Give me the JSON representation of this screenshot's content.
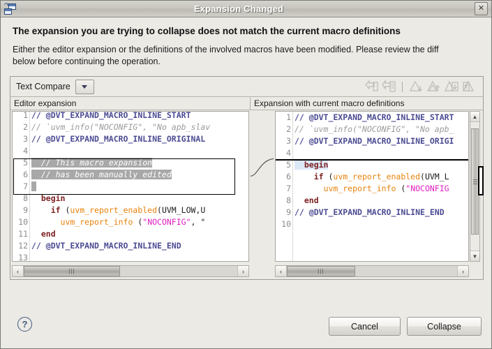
{
  "window": {
    "title": "Expansion Changed",
    "icon": "compare-windows-icon",
    "close_label": "✕"
  },
  "header": {
    "heading": "The expansion you are trying to collapse does not match the current macro definitions",
    "description": "Either the editor expansion or the definitions of the involved macros have been modified. Please review the diff below before continuing the operation."
  },
  "compare_viewer": {
    "mode_label": "Text Compare",
    "dropdown_icon": "chevron-down-icon",
    "toolbar_icons": [
      "copy-all-left-to-right-icon",
      "copy-current-change-icon",
      "next-difference-icon",
      "previous-difference-icon",
      "next-change-icon",
      "previous-change-icon"
    ],
    "left_pane": {
      "header": "Editor expansion",
      "lines": [
        {
          "num": "1",
          "tokens": [
            {
              "t": "// @DVT_EXPAND_MACRO_INLINE_START",
              "c": "c-cmt"
            }
          ]
        },
        {
          "num": "2",
          "tokens": [
            {
              "t": "// ",
              "c": "c-cmt-i"
            },
            {
              "t": "`uvm_info(\"NOCONFIG\", \"No apb_slav",
              "c": "c-cmt-i"
            }
          ]
        },
        {
          "num": "3",
          "tokens": [
            {
              "t": "// @DVT_EXPAND_MACRO_INLINE_ORIGINAL",
              "c": "c-cmt"
            }
          ]
        },
        {
          "num": "4",
          "tokens": []
        },
        {
          "num": "5",
          "tokens": [
            {
              "t": "  // This macro expansion",
              "c": "c-cmt-i hl-gray"
            }
          ]
        },
        {
          "num": "6",
          "tokens": [
            {
              "t": "  // has been manually edited",
              "c": "c-cmt-i hl-gray"
            }
          ]
        },
        {
          "num": "7",
          "tokens": [
            {
              "t": " ",
              "c": "hl-gray"
            }
          ]
        },
        {
          "num": "8",
          "tokens": [
            {
              "t": "  begin",
              "c": "c-kw"
            }
          ]
        },
        {
          "num": "9",
          "tokens": [
            {
              "t": "    if",
              "c": "c-kw"
            },
            {
              "t": " (",
              "c": "c-plain"
            },
            {
              "t": "uvm_report_enabled",
              "c": "c-fn"
            },
            {
              "t": "(UVM_LOW,U",
              "c": "c-plain"
            }
          ]
        },
        {
          "num": "10",
          "tokens": [
            {
              "t": "      ",
              "c": "c-plain"
            },
            {
              "t": "uvm_report_info",
              "c": "c-fn"
            },
            {
              "t": " (",
              "c": "c-plain"
            },
            {
              "t": "\"NOCONFIG\"",
              "c": "c-str"
            },
            {
              "t": ", \"",
              "c": "c-plain"
            }
          ]
        },
        {
          "num": "11",
          "tokens": [
            {
              "t": "  end",
              "c": "c-kw"
            }
          ]
        },
        {
          "num": "12",
          "tokens": [
            {
              "t": "// @DVT_EXPAND_MACRO_INLINE_END",
              "c": "c-cmt"
            }
          ]
        },
        {
          "num": "13",
          "tokens": []
        }
      ],
      "hscroll": {
        "left_arrow": "‹",
        "right_arrow": "›",
        "grip": "|||"
      }
    },
    "right_pane": {
      "header": "Expansion with current macro definitions",
      "lines": [
        {
          "num": "1",
          "tokens": [
            {
              "t": "// @DVT_EXPAND_MACRO_INLINE_START",
              "c": "c-cmt"
            }
          ]
        },
        {
          "num": "2",
          "tokens": [
            {
              "t": "// `uvm_info(\"NOCONFIG\", \"No apb_",
              "c": "c-cmt-i"
            }
          ]
        },
        {
          "num": "3",
          "tokens": [
            {
              "t": "// @DVT_EXPAND_MACRO_INLINE_ORIGI",
              "c": "c-cmt"
            }
          ]
        },
        {
          "num": "4",
          "tokens": []
        },
        {
          "num": "5",
          "tokens": [
            {
              "t": "  begin",
              "c": "c-kw hl-blue"
            }
          ]
        },
        {
          "num": "6",
          "tokens": [
            {
              "t": "    if",
              "c": "c-kw"
            },
            {
              "t": " (",
              "c": "c-plain"
            },
            {
              "t": "uvm_report_enabled",
              "c": "c-fn"
            },
            {
              "t": "(UVM_L",
              "c": "c-plain"
            }
          ]
        },
        {
          "num": "7",
          "tokens": [
            {
              "t": "      ",
              "c": "c-plain"
            },
            {
              "t": "uvm_report_info",
              "c": "c-fn"
            },
            {
              "t": " (",
              "c": "c-plain"
            },
            {
              "t": "\"NOCONFIG",
              "c": "c-str"
            }
          ]
        },
        {
          "num": "8",
          "tokens": [
            {
              "t": "  end",
              "c": "c-kw"
            }
          ]
        },
        {
          "num": "9",
          "tokens": [
            {
              "t": "// @DVT_EXPAND_MACRO_INLINE_END",
              "c": "c-cmt"
            }
          ]
        },
        {
          "num": "10",
          "tokens": []
        }
      ],
      "vscroll": {
        "up_arrow": "▲",
        "down_arrow": "▼"
      },
      "hscroll": {
        "left_arrow": "‹",
        "right_arrow": "›",
        "grip": "|||"
      }
    }
  },
  "footer": {
    "help_label": "?",
    "cancel_label": "Cancel",
    "collapse_label": "Collapse"
  },
  "colors": {
    "dialog_bg": "#eceae5",
    "code_bg": "#ffffff",
    "comment_bold": "#4b4b93",
    "comment_italic": "#9a9a9a",
    "keyword": "#7a1f1f",
    "function": "#e8820a",
    "string": "#e020c0",
    "selection_gray": "#a8a8a8",
    "diff_blue": "#dde8f7"
  }
}
